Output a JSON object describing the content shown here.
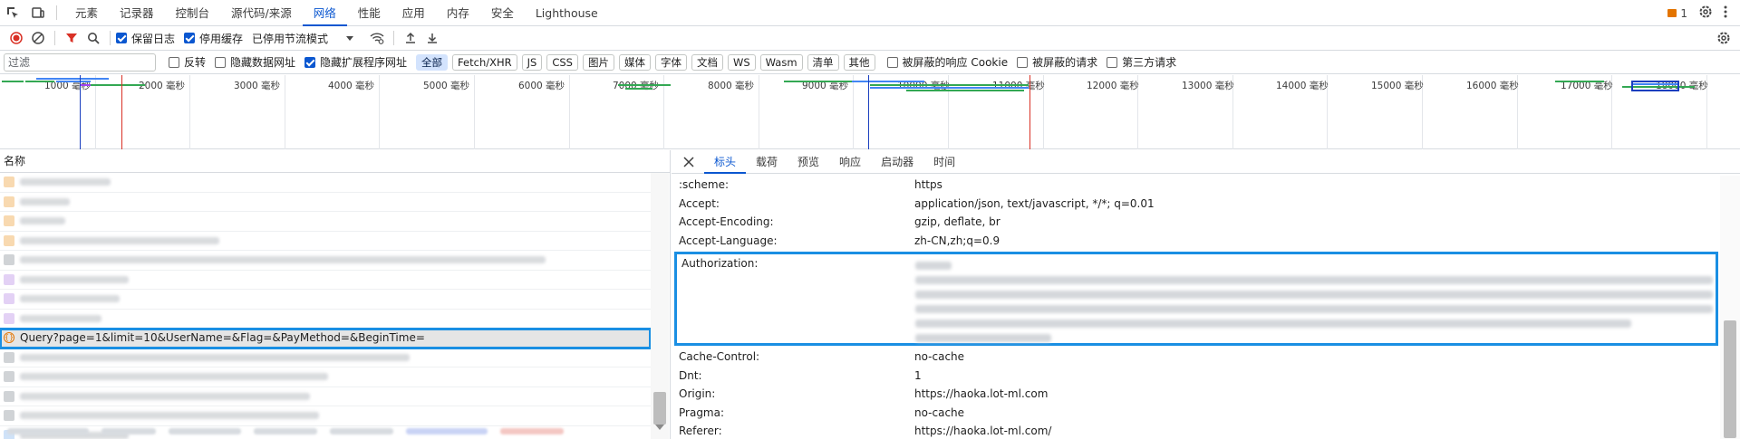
{
  "topbar": {
    "tabs": [
      "元素",
      "记录器",
      "控制台",
      "源代码/来源",
      "网络",
      "性能",
      "应用",
      "内存",
      "安全",
      "Lighthouse"
    ],
    "active_tab": "网络",
    "issues_count": "1"
  },
  "toolbar": {
    "preserve_log": "保留日志",
    "disable_cache": "停用缓存",
    "throttle": "已停用节流模式"
  },
  "filter": {
    "placeholder": "过滤",
    "invert": "反转",
    "hide_data_urls": "隐藏数据网址",
    "hide_extension_urls": "隐藏扩展程序网址",
    "types": [
      "全部",
      "Fetch/XHR",
      "JS",
      "CSS",
      "图片",
      "媒体",
      "字体",
      "文档",
      "WS",
      "Wasm",
      "清单",
      "其他"
    ],
    "blocked_cookies": "被屏蔽的响应 Cookie",
    "blocked_requests": "被屏蔽的请求",
    "third_party": "第三方请求"
  },
  "overview": {
    "ticks": [
      "1000 毫秒",
      "2000 毫秒",
      "3000 毫秒",
      "4000 毫秒",
      "5000 毫秒",
      "6000 毫秒",
      "7000 毫秒",
      "8000 毫秒",
      "9000 毫秒",
      "10000 毫秒",
      "11000 毫秒",
      "12000 毫秒",
      "13000 毫秒",
      "14000 毫秒",
      "15000 毫秒",
      "16000 毫秒",
      "17000 毫秒",
      "18000 毫秒"
    ]
  },
  "requests": {
    "column_name": "名称",
    "selected_request": "Query?page=1&limit=10&UserName=&Flag=&PayMethod=&BeginTime="
  },
  "detail": {
    "tabs": [
      "标头",
      "载荷",
      "预览",
      "响应",
      "启动器",
      "时间"
    ],
    "active_tab": "标头",
    "headers_before": [
      {
        "k": ":scheme:",
        "v": "https"
      },
      {
        "k": "Accept:",
        "v": "application/json, text/javascript, */*; q=0.01"
      },
      {
        "k": "Accept-Encoding:",
        "v": "gzip, deflate, br"
      },
      {
        "k": "Accept-Language:",
        "v": "zh-CN,zh;q=0.9"
      }
    ],
    "auth_key": "Authorization:",
    "headers_after": [
      {
        "k": "Cache-Control:",
        "v": "no-cache"
      },
      {
        "k": "Dnt:",
        "v": "1"
      },
      {
        "k": "Origin:",
        "v": "https://haoka.lot-ml.com"
      },
      {
        "k": "Pragma:",
        "v": "no-cache"
      },
      {
        "k": "Referer:",
        "v": "https://haoka.lot-ml.com/"
      }
    ]
  }
}
